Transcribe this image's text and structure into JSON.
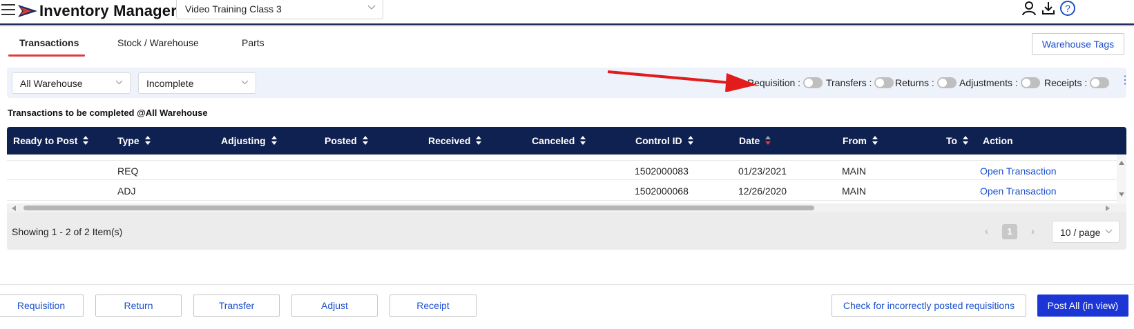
{
  "header": {
    "app_title": "Inventory Manager",
    "class_selector": {
      "value": "Video Training Class 3"
    },
    "icons": [
      "menu-icon",
      "logo-icon",
      "user-icon",
      "download-icon",
      "help-icon"
    ]
  },
  "tabs": [
    {
      "label": "Transactions",
      "active": true
    },
    {
      "label": "Stock / Warehouse",
      "active": false
    },
    {
      "label": "Parts",
      "active": false
    }
  ],
  "warehouse_tags_label": "Warehouse Tags",
  "filters": {
    "warehouse": "All Warehouse",
    "status": "Incomplete",
    "toggles": [
      {
        "label": "Requisition :",
        "on": false
      },
      {
        "label": "Transfers :",
        "on": false
      },
      {
        "label": "Returns :",
        "on": false
      },
      {
        "label": "Adjustments :",
        "on": false
      },
      {
        "label": "Receipts :",
        "on": false
      }
    ]
  },
  "section_title": "Transactions to be completed @All Warehouse",
  "table": {
    "columns": [
      "Ready to Post",
      "Type",
      "Adjusting",
      "Posted",
      "Received",
      "Canceled",
      "Control ID",
      "Date",
      "From",
      "To",
      "Action"
    ],
    "rows": [
      {
        "ready_to_post": "",
        "type": "REQ",
        "adjusting": "",
        "posted": "",
        "received": "",
        "canceled": "",
        "control_id": "1502000083",
        "date": "01/23/2021",
        "from": "MAIN",
        "to": "",
        "action": "Open Transaction"
      },
      {
        "ready_to_post": "",
        "type": "ADJ",
        "adjusting": "",
        "posted": "",
        "received": "",
        "canceled": "",
        "control_id": "1502000068",
        "date": "12/26/2020",
        "from": "MAIN",
        "to": "",
        "action": "Open Transaction"
      }
    ]
  },
  "pagination": {
    "showing": "Showing 1 - 2 of 2 Item(s)",
    "current_page": "1",
    "page_size": "10 / page"
  },
  "actions": {
    "requisition": "Requisition",
    "return": "Return",
    "transfer": "Transfer",
    "adjust": "Adjust",
    "receipt": "Receipt",
    "check_incorrect": "Check for incorrectly posted requisitions",
    "post_all": "Post All (in view)"
  },
  "colors": {
    "header_rule_blue": "#1b2a5a",
    "header_rule_red": "#d23a3a",
    "table_header_bg": "#0f2150",
    "link_blue": "#1a4fcf",
    "primary_button": "#1c36d6",
    "active_tab_underline": "#e03b3b"
  }
}
